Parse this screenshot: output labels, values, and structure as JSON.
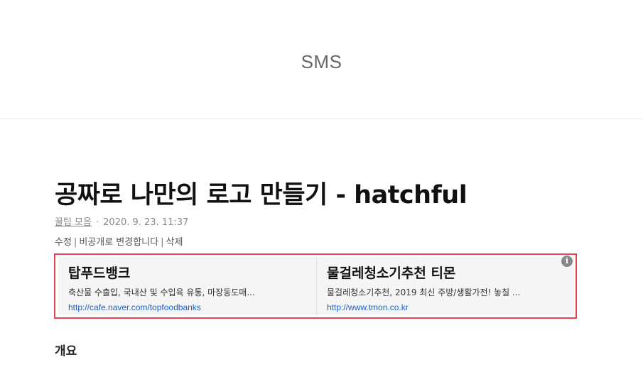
{
  "site": {
    "title": "SMS"
  },
  "post": {
    "title": "공짜로 나만의 로고 만들기 - hatchful",
    "category": "꿀팁 모음",
    "meta_separator": "·",
    "date": "2020. 9. 23. 11:37",
    "admin": {
      "edit": "수정",
      "make_private": "비공개로 변경합니다",
      "delete": "삭제",
      "separator": "|"
    }
  },
  "ads": {
    "info_glyph": "i",
    "items": [
      {
        "headline": "탑푸드뱅크",
        "description": "축산물 수출입, 국내산 및 수입육 유통, 마장동도매...",
        "url": "http://cafe.naver.com/topfoodbanks"
      },
      {
        "headline": "물걸레청소기추천 티몬",
        "description": "물걸레청소기추천, 2019 최신 주방/생활가전! 놓칠 ...",
        "url": "http://www.tmon.co.kr"
      }
    ],
    "highlight_color": "#e8434f"
  },
  "content": {
    "first_heading": "개요"
  }
}
